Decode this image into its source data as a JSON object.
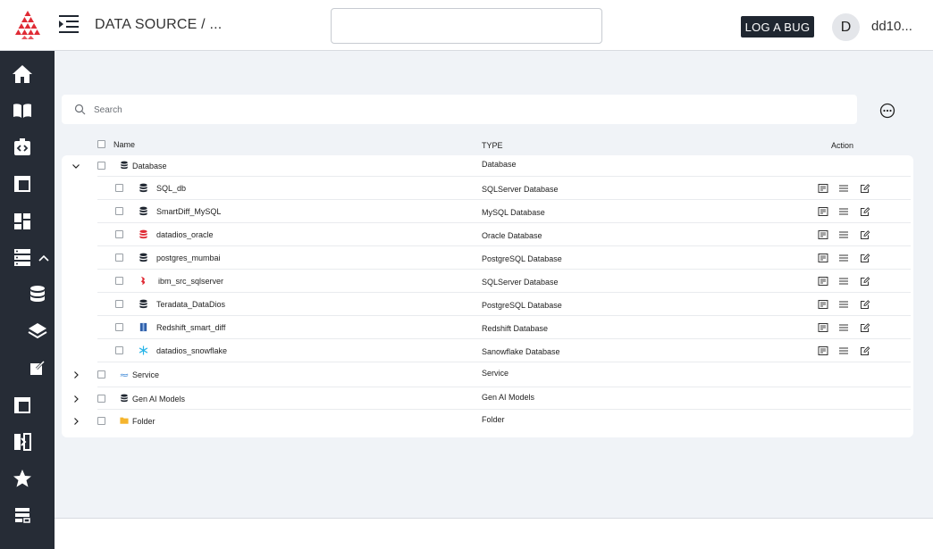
{
  "header": {
    "breadcrumb": "DATA SOURCE / ...",
    "top_search_value": "",
    "log_bug_label": "LOG  A BUG",
    "avatar_initial": "D",
    "username": "dd10..."
  },
  "sidebar": {
    "icons": [
      "home-icon",
      "book-icon",
      "code-icon",
      "dashboard-icon",
      "grid-icon",
      "server-icon",
      "chevron-up-icon",
      "database-icon",
      "layers-icon",
      "edit-icon",
      "panel-icon",
      "compare-icon",
      "star-icon",
      "stack-icon"
    ]
  },
  "search": {
    "placeholder": "Search",
    "value": ""
  },
  "table": {
    "headers": {
      "name": "Name",
      "type": "TYPE",
      "action": "Action"
    },
    "groups": [
      {
        "name": "Database",
        "type": "Database",
        "expanded": true,
        "icon": "database-icon",
        "items": [
          {
            "name": "SQL_db",
            "type": "SQLServer Database",
            "icon": "database-icon"
          },
          {
            "name": "SmartDiff_MySQL",
            "type": "MySQL Database",
            "icon": "database-icon"
          },
          {
            "name": "datadios_oracle",
            "type": "Oracle Database",
            "icon": "oracle-icon"
          },
          {
            "name": "postgres_mumbai",
            "type": "PostgreSQL Database",
            "icon": "database-icon"
          },
          {
            "name": "ibm_src_sqlserver",
            "type": "SQLServer Database",
            "icon": "sqlserver-icon"
          },
          {
            "name": "Teradata_DataDios",
            "type": "PostgreSQL Database",
            "icon": "database-icon"
          },
          {
            "name": "Redshift_smart_diff",
            "type": "Redshift Database",
            "icon": "redshift-icon"
          },
          {
            "name": "datadios_snowflake",
            "type": "Sanowflake Database",
            "icon": "snowflake-icon"
          }
        ]
      },
      {
        "name": "Service",
        "type": "Service",
        "expanded": false,
        "icon": "cloud-icon",
        "items": []
      },
      {
        "name": "Gen AI Models",
        "type": "Gen AI Models",
        "expanded": false,
        "icon": "database-icon",
        "items": []
      },
      {
        "name": "Folder",
        "type": "Folder",
        "expanded": false,
        "icon": "folder-icon",
        "items": []
      }
    ],
    "row_actions": [
      "details-icon",
      "menu-icon",
      "edit-icon"
    ]
  },
  "colors": {
    "sidebar_bg": "#262c36",
    "main_bg": "#f0f3f7",
    "button_dark": "#1f2630",
    "logo_red": "#e02b35",
    "folder_yellow": "#f5b52e",
    "snowflake_blue": "#29b5e8",
    "redshift_blue": "#2f5fa8"
  }
}
